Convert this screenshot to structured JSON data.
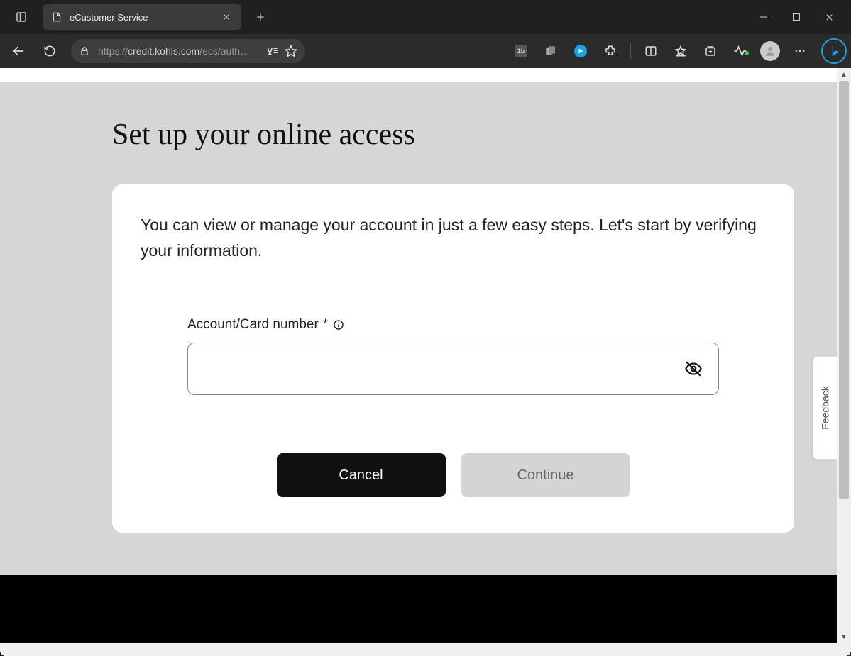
{
  "browser": {
    "tab_title": "eCustomer Service",
    "url_prefix": "https://",
    "url_host": "credit.kohls.com",
    "url_path": "/ecs/auth…"
  },
  "page": {
    "title": "Set up your online access",
    "intro": "You can view or manage your account in just a few easy steps. Let's start by verifying your information.",
    "field_label": "Account/Card number",
    "required_marker": "*",
    "input_value": "",
    "cancel_label": "Cancel",
    "continue_label": "Continue",
    "feedback_label": "Feedback"
  }
}
